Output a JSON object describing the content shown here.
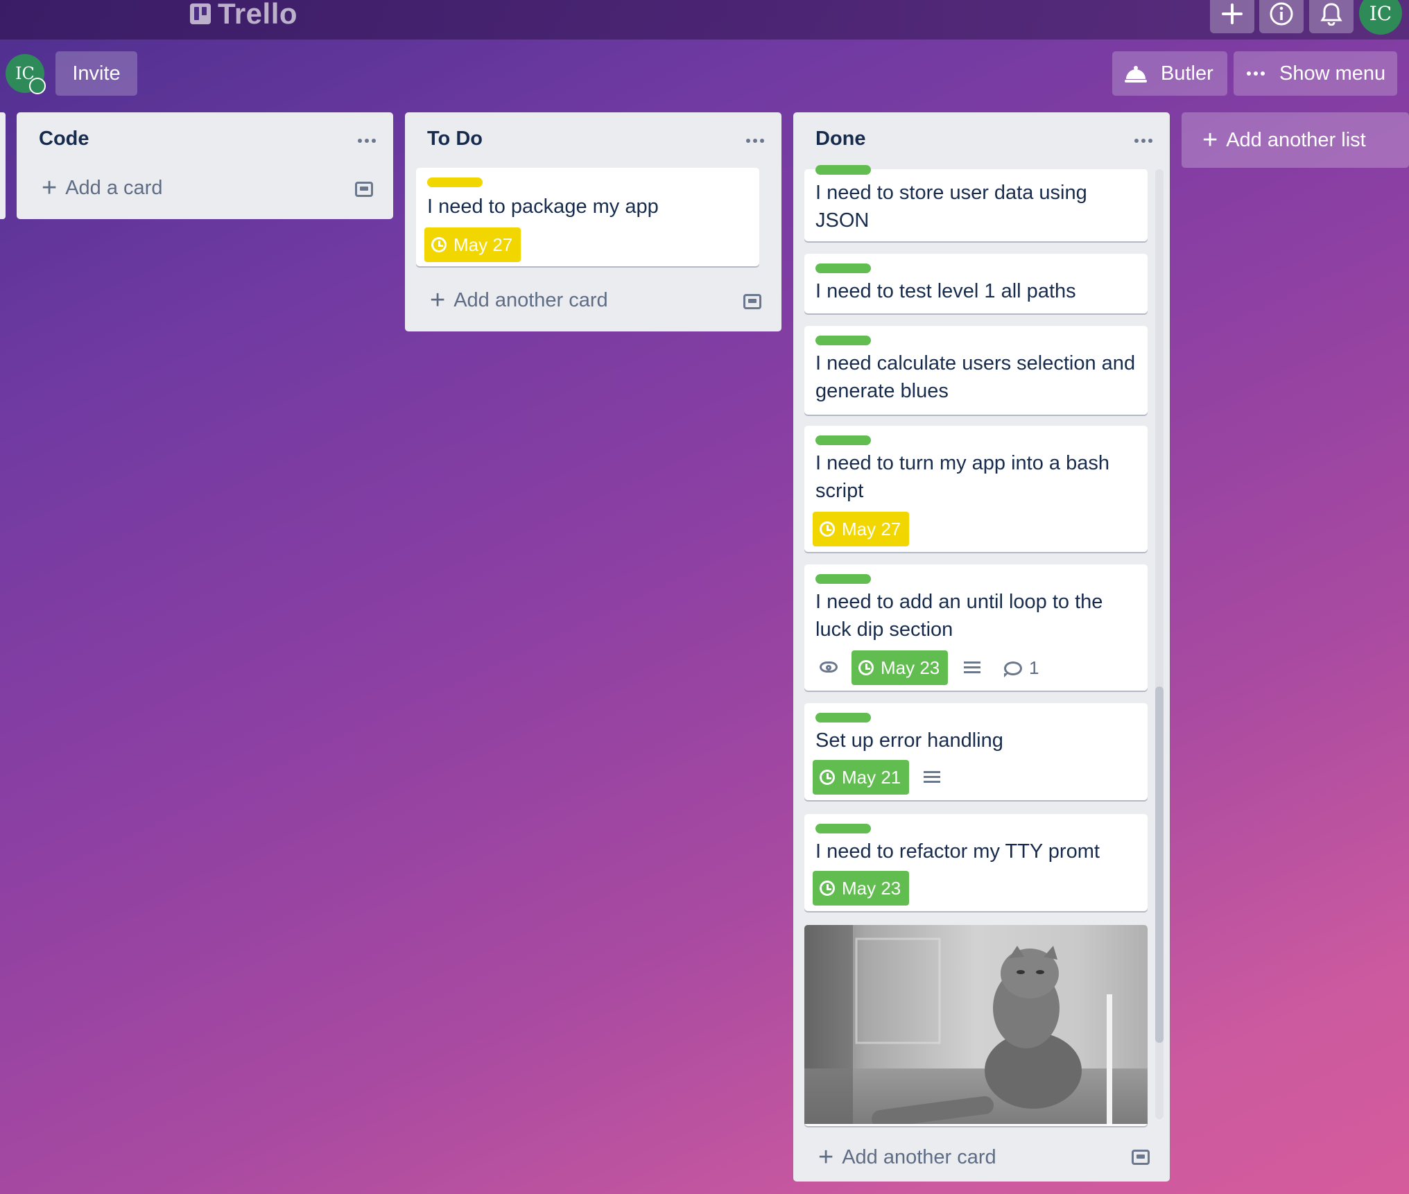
{
  "app": {
    "name": "Trello"
  },
  "header": {
    "avatar_initials": "IC",
    "invite_label": "Invite",
    "butler_label": "Butler",
    "show_menu_label": "Show menu"
  },
  "topbar": {
    "avatar_initials": "IC"
  },
  "lists": [
    {
      "title": "Code",
      "add_label": "Add a card",
      "cards": []
    },
    {
      "title": "To Do",
      "add_label": "Add another card",
      "cards": [
        {
          "label_color": "#f2d600",
          "text": "I need to package my app",
          "due": "May 27",
          "due_color": "#f2d600"
        }
      ]
    },
    {
      "title": "Done",
      "add_label": "Add another card",
      "cards": [
        {
          "label_color": "#61bd4f",
          "text": "I need to store user data using JSON"
        },
        {
          "label_color": "#61bd4f",
          "text": "I need to test level 1 all paths"
        },
        {
          "label_color": "#61bd4f",
          "text": "I need calculate users selection and generate blues"
        },
        {
          "label_color": "#61bd4f",
          "text": "I need to turn my app into a bash script",
          "due": "May 27",
          "due_color": "#f2d600"
        },
        {
          "label_color": "#61bd4f",
          "text": "I need to add an until loop to the luck dip section",
          "due": "May 23",
          "due_color": "#61bd4f",
          "comments": "1"
        },
        {
          "label_color": "#61bd4f",
          "text": "Set up error handling",
          "due": "May 21",
          "due_color": "#61bd4f"
        },
        {
          "label_color": "#61bd4f",
          "text": "I need to refactor my TTY promt",
          "due": "May 23",
          "due_color": "#61bd4f"
        }
      ]
    }
  ],
  "add_list_label": "Add another list",
  "icons": {
    "plus": "plus-icon",
    "info": "info-icon",
    "bell": "bell-icon",
    "butler": "butler-bell-icon",
    "more": "ellipsis-icon",
    "clock": "clock-icon",
    "eye": "eye-icon",
    "description": "description-icon",
    "comment": "comment-icon",
    "template": "card-template-icon"
  }
}
